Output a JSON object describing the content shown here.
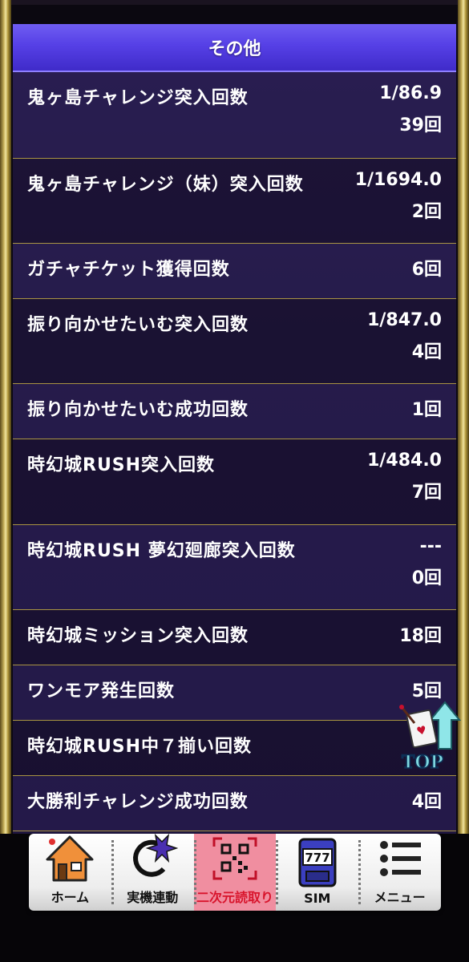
{
  "section_title": "その他",
  "rows": [
    {
      "label": "鬼ヶ島チャレンジ突入回数",
      "value1": "1/86.9",
      "value2": "39回"
    },
    {
      "label": "鬼ヶ島チャレンジ（妹）突入回数",
      "value1": "1/1694.0",
      "value2": "2回"
    },
    {
      "label": "ガチャチケット獲得回数",
      "value1": "6回",
      "value2": ""
    },
    {
      "label": "振り向かせたいむ突入回数",
      "value1": "1/847.0",
      "value2": "4回"
    },
    {
      "label": "振り向かせたいむ成功回数",
      "value1": "1回",
      "value2": ""
    },
    {
      "label": "時幻城RUSH突入回数",
      "value1": "1/484.0",
      "value2": "7回"
    },
    {
      "label": "時幻城RUSH 夢幻廻廊突入回数",
      "value1": "---",
      "value2": "0回"
    },
    {
      "label": "時幻城ミッション突入回数",
      "value1": "18回",
      "value2": ""
    },
    {
      "label": "ワンモア発生回数",
      "value1": "5回",
      "value2": ""
    },
    {
      "label": "時幻城RUSH中７揃い回数",
      "value1": "",
      "value2": ""
    },
    {
      "label": "大勝利チャレンジ成功回数",
      "value1": "4回",
      "value2": ""
    }
  ],
  "top_button": {
    "label": "TOP",
    "icon": "playing-card-arrow-up-icon"
  },
  "nav": {
    "home": {
      "label": "ホーム",
      "icon": "house-icon"
    },
    "sync": {
      "label": "実機連動",
      "icon": "sync-emblem-icon"
    },
    "qr": {
      "label": "二次元読取り",
      "icon": "qr-code-icon"
    },
    "sim": {
      "label": "SIM",
      "icon": "slot-machine-777-icon",
      "reels": "777"
    },
    "menu": {
      "label": "メニュー",
      "icon": "list-menu-icon"
    }
  },
  "colors": {
    "header": "#5640e6",
    "divider": "#a89342",
    "active_tab": "#f08ea0",
    "active_label": "#d8142c"
  }
}
